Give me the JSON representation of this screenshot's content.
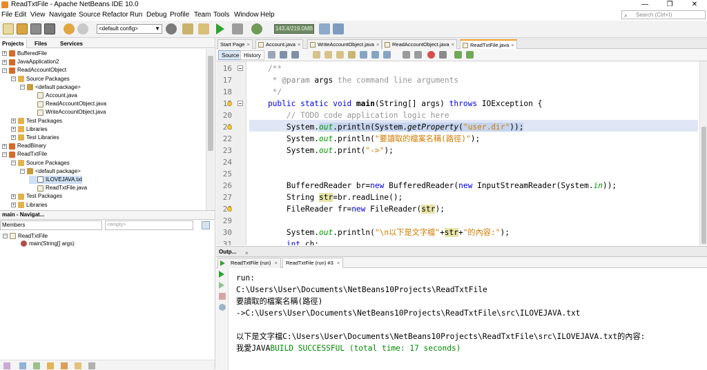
{
  "window": {
    "title": "ReadTxtFile - Apache NetBeans IDE 10.0",
    "min_glyph": "—",
    "max_glyph": "❐",
    "close_glyph": "✕"
  },
  "menu": [
    "File",
    "Edit",
    "View",
    "Navigate",
    "Source",
    "Refactor",
    "Run",
    "Debug",
    "Profile",
    "Team",
    "Tools",
    "Window",
    "Help"
  ],
  "search": {
    "placeholder": "Search (Ctrl+I)"
  },
  "toolbar": {
    "config": "<default config>",
    "memory": "143.4/219.0MB"
  },
  "left_panel": {
    "tabs": [
      "Projects",
      "Files",
      "Services"
    ],
    "tree": [
      {
        "label": "BufferedFile",
        "expander": "+",
        "icon": "project"
      },
      {
        "label": "JavaApplication2",
        "expander": "+",
        "icon": "project"
      },
      {
        "label": "ReadAccountObject",
        "expander": "−",
        "icon": "project"
      },
      {
        "label": "Source Packages",
        "expander": "−",
        "icon": "package-folder"
      },
      {
        "label": "<default package>",
        "expander": "−",
        "icon": "package"
      },
      {
        "label": "Account.java",
        "expander": "",
        "icon": "java-file"
      },
      {
        "label": "ReadAccountObject.java",
        "expander": "",
        "icon": "java-file"
      },
      {
        "label": "WriteAccountObject.java",
        "expander": "",
        "icon": "java-file"
      },
      {
        "label": "Test Packages",
        "expander": "+",
        "icon": "package-folder"
      },
      {
        "label": "Libraries",
        "expander": "+",
        "icon": "package-folder"
      },
      {
        "label": "Test Libraries",
        "expander": "+",
        "icon": "package-folder"
      },
      {
        "label": "ReadBinary",
        "expander": "+",
        "icon": "project"
      },
      {
        "label": "ReadTxtFile",
        "expander": "−",
        "icon": "project"
      },
      {
        "label": "Source Packages",
        "expander": "−",
        "icon": "package-folder"
      },
      {
        "label": "<default package>",
        "expander": "−",
        "icon": "package"
      },
      {
        "label": "ILOVEJAVA.txt",
        "expander": "",
        "icon": "text-file"
      },
      {
        "label": "ReadTxtFile.java",
        "expander": "",
        "icon": "java-file"
      },
      {
        "label": "Test Packages",
        "expander": "+",
        "icon": "package-folder"
      },
      {
        "label": "Libraries",
        "expander": "+",
        "icon": "package-folder"
      }
    ]
  },
  "navigator": {
    "title": "main - Navigat...",
    "members": "Members",
    "filter_placeholder": "<empty>",
    "root": "ReadTxtFile",
    "method": "main(String[] args)"
  },
  "editor_tabs": [
    {
      "label": "Start Page",
      "active": false
    },
    {
      "label": "Account.java",
      "active": false
    },
    {
      "label": "WriteAccountObject.java",
      "active": false
    },
    {
      "label": "ReadAccountObject.java",
      "active": false
    },
    {
      "label": "ReadTxtFile.java",
      "active": true
    }
  ],
  "editor_toolbar": {
    "source": "Source",
    "history": "History"
  },
  "editor": {
    "lines": [
      {
        "n": "16",
        "code": [
          {
            "t": "    /**",
            "c": "cm"
          }
        ]
      },
      {
        "n": "17",
        "code": [
          {
            "t": "     * ",
            "c": "cm"
          },
          {
            "t": "@param",
            "c": "cmt"
          },
          {
            "t": " args ",
            "c": ""
          },
          {
            "t": "the command line arguments",
            "c": "cm"
          }
        ]
      },
      {
        "n": "18",
        "code": [
          {
            "t": "     */",
            "c": "cm"
          }
        ]
      },
      {
        "n": "19",
        "code": [
          {
            "t": "    public static void ",
            "c": "kw"
          },
          {
            "t": "main",
            "c": "mb"
          },
          {
            "t": "(String[] args) ",
            "c": ""
          },
          {
            "t": "throws",
            "c": "kw"
          },
          {
            "t": " IOException {",
            "c": ""
          }
        ]
      },
      {
        "n": "20",
        "code": [
          {
            "t": "        // TODO code application logic here",
            "c": "cm"
          }
        ]
      },
      {
        "n": "21",
        "code": [
          {
            "t": "        System.",
            "c": ""
          },
          {
            "t": "out",
            "c": "fld"
          },
          {
            "t": ".println(System.",
            "c": ""
          },
          {
            "t": "getProperty",
            "c": "stat"
          },
          {
            "t": "(",
            "c": ""
          },
          {
            "t": "\"user.dir\"",
            "c": "str"
          },
          {
            "t": "));",
            "c": ""
          }
        ]
      },
      {
        "n": "22",
        "code": [
          {
            "t": "        System.",
            "c": ""
          },
          {
            "t": "out",
            "c": "fld"
          },
          {
            "t": ".println(",
            "c": ""
          },
          {
            "t": "\"要讀取的檔案名稱(路徑)\"",
            "c": "str"
          },
          {
            "t": ");",
            "c": ""
          }
        ]
      },
      {
        "n": "23",
        "code": [
          {
            "t": "        System.",
            "c": ""
          },
          {
            "t": "out",
            "c": "fld"
          },
          {
            "t": ".print(",
            "c": ""
          },
          {
            "t": "\"->\"",
            "c": "str"
          },
          {
            "t": ");",
            "c": ""
          }
        ]
      },
      {
        "n": "24",
        "code": []
      },
      {
        "n": "25",
        "code": []
      },
      {
        "n": "26",
        "code": [
          {
            "t": "        BufferedReader br=",
            "c": ""
          },
          {
            "t": "new",
            "c": "kw"
          },
          {
            "t": " BufferedReader(",
            "c": ""
          },
          {
            "t": "new",
            "c": "kw"
          },
          {
            "t": " InputStreamReader(System.",
            "c": ""
          },
          {
            "t": "in",
            "c": "fld"
          },
          {
            "t": "));",
            "c": ""
          }
        ]
      },
      {
        "n": "27",
        "code": [
          {
            "t": "        String ",
            "c": ""
          },
          {
            "t": "str",
            "c": "hl"
          },
          {
            "t": "=br.readLine();",
            "c": ""
          }
        ]
      },
      {
        "n": "28",
        "code": [
          {
            "t": "        FileReader fr=",
            "c": ""
          },
          {
            "t": "new",
            "c": "kw"
          },
          {
            "t": " FileReader(",
            "c": ""
          },
          {
            "t": "str",
            "c": "hl"
          },
          {
            "t": ");",
            "c": ""
          }
        ]
      },
      {
        "n": "29",
        "code": []
      },
      {
        "n": "30",
        "code": [
          {
            "t": "        System.",
            "c": ""
          },
          {
            "t": "out",
            "c": "fld"
          },
          {
            "t": ".println(",
            "c": ""
          },
          {
            "t": "\"\\n以下是文字檔\"",
            "c": "str"
          },
          {
            "t": "+",
            "c": ""
          },
          {
            "t": "str",
            "c": "hl"
          },
          {
            "t": "+",
            "c": ""
          },
          {
            "t": "\"的內容:\"",
            "c": "str"
          },
          {
            "t": ");",
            "c": ""
          }
        ]
      },
      {
        "n": "31",
        "code": [
          {
            "t": "        int",
            "c": "kw"
          },
          {
            "t": " ch;",
            "c": ""
          }
        ]
      }
    ]
  },
  "output": {
    "title": "Outp...",
    "tabs": [
      {
        "label": "ReadTxtFile (run)",
        "active": false
      },
      {
        "label": "ReadTxtFile (run) #3",
        "active": true
      }
    ],
    "lines": [
      {
        "t": "run:",
        "c": ""
      },
      {
        "t": "C:\\Users\\User\\Documents\\NetBeans10Projects\\ReadTxtFile",
        "c": ""
      },
      {
        "t": "要讀取的檔案名稱(路徑)",
        "c": ""
      },
      {
        "t": "->C:\\Users\\User\\Documents\\NetBeans10Projects\\ReadTxtFile\\src\\ILOVEJAVA.txt",
        "c": ""
      },
      {
        "t": "",
        "c": ""
      },
      {
        "t": "以下是文字檔C:\\Users\\User\\Documents\\NetBeans10Projects\\ReadTxtFile\\src\\ILOVEJAVA.txt的內容:",
        "c": ""
      }
    ],
    "last_prefix": "我愛JAVA",
    "last_build": "BUILD SUCCESSFUL (total time: 17 seconds)"
  }
}
